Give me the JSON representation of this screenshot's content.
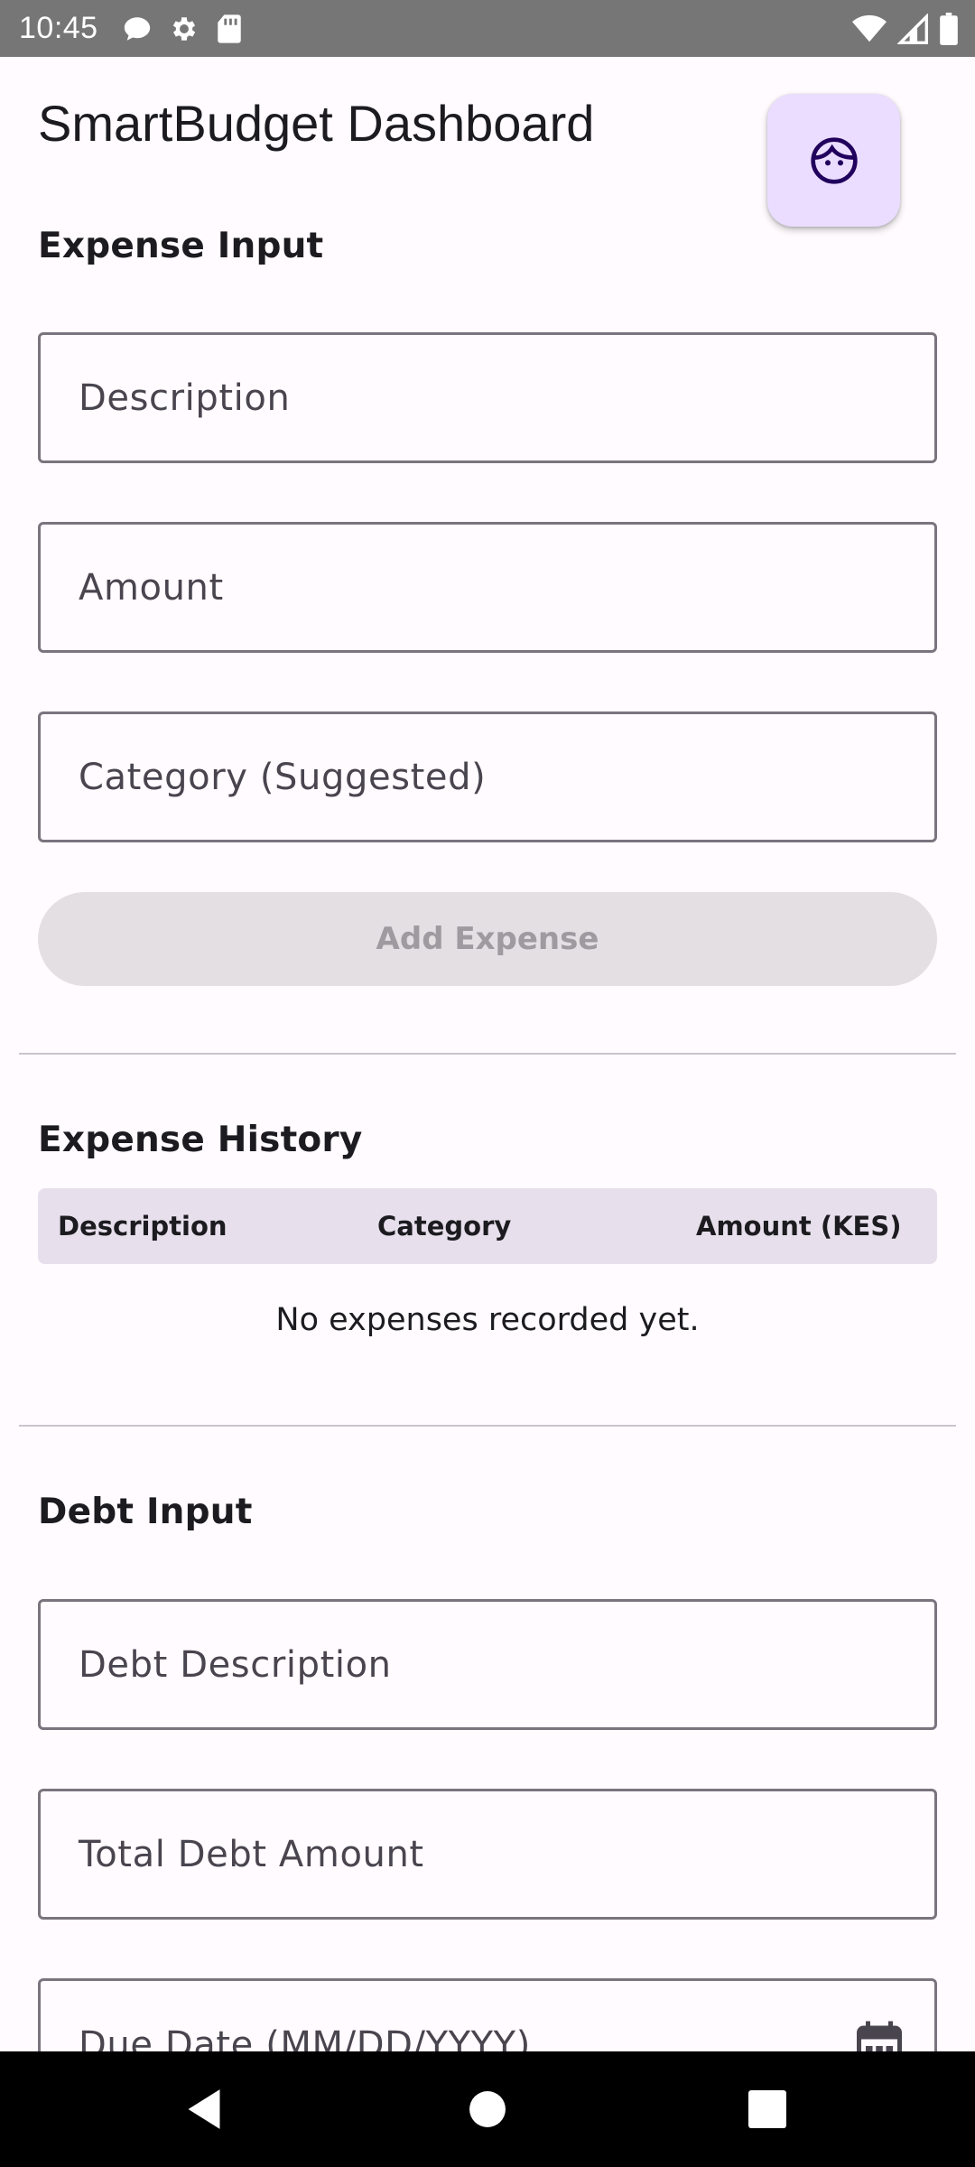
{
  "status_bar": {
    "time": "10:45",
    "left_icons": [
      "chat-bubble-icon",
      "gear-icon",
      "sd-card-icon"
    ],
    "right_icons": [
      "wifi-icon",
      "signal-icon",
      "battery-icon"
    ]
  },
  "header": {
    "title": "SmartBudget Dashboard",
    "fab_icon": "face-icon"
  },
  "expense_input": {
    "title": "Expense Input",
    "fields": {
      "description": {
        "placeholder": "Description",
        "value": ""
      },
      "amount": {
        "placeholder": "Amount",
        "value": ""
      },
      "category": {
        "placeholder": "Category (Suggested)",
        "value": ""
      }
    },
    "add_button": "Add Expense"
  },
  "expense_history": {
    "title": "Expense History",
    "columns": [
      "Description",
      "Category",
      "Amount (KES)"
    ],
    "rows": [],
    "empty_message": "No expenses recorded yet."
  },
  "debt_input": {
    "title": "Debt Input",
    "fields": {
      "description": {
        "placeholder": "Debt Description",
        "value": ""
      },
      "total_amount": {
        "placeholder": "Total Debt Amount",
        "value": ""
      },
      "due_date": {
        "placeholder": "Due Date (MM/DD/YYYY)",
        "value": "",
        "icon": "calendar-icon"
      }
    }
  },
  "nav_bar": {
    "buttons": [
      "back-icon",
      "home-icon",
      "recents-icon"
    ]
  },
  "colors": {
    "background": "#FFFBFE",
    "fab": "#EADDFF",
    "outline": "#79747E",
    "table_header": "#E7E0EC",
    "disabled_button": "#E3DFE3"
  }
}
